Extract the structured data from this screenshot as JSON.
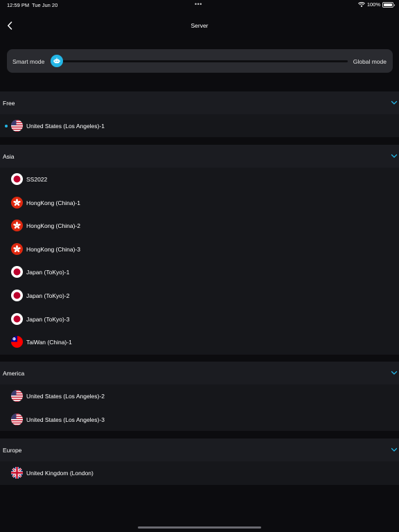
{
  "status_bar": {
    "time": "12:59 PM",
    "date": "Tue Jun 20",
    "battery": "100%"
  },
  "nav": {
    "title": "Server"
  },
  "mode": {
    "left_label": "Smart mode",
    "right_label": "Global mode",
    "selected": "Smart mode"
  },
  "groups": [
    {
      "title": "Free",
      "items": [
        {
          "label": "United States (Los Angeles)-1",
          "flag": "us",
          "selected": true
        }
      ]
    },
    {
      "title": "Asia",
      "items": [
        {
          "label": "SS2022",
          "flag": "jp"
        },
        {
          "label": "HongKong (China)-1",
          "flag": "hk"
        },
        {
          "label": "HongKong (China)-2",
          "flag": "hk"
        },
        {
          "label": "HongKong (China)-3",
          "flag": "hk"
        },
        {
          "label": "Japan (ToKyo)-1",
          "flag": "jp"
        },
        {
          "label": "Japan (ToKyo)-2",
          "flag": "jp"
        },
        {
          "label": "Japan (ToKyo)-3",
          "flag": "jp"
        },
        {
          "label": "TaiWan (China)-1",
          "flag": "tw"
        }
      ]
    },
    {
      "title": "America",
      "items": [
        {
          "label": "United States (Los Angeles)-2",
          "flag": "us"
        },
        {
          "label": "United States (Los Angeles)-3",
          "flag": "us"
        }
      ]
    },
    {
      "title": "Europe",
      "items": [
        {
          "label": "United Kingdom (London)",
          "flag": "gb"
        }
      ]
    }
  ],
  "icons": {
    "back": "chevron-left-icon",
    "expand": "chevron-down-icon",
    "mode_thumb": "robot-icon",
    "wifi": "wifi-icon",
    "battery": "battery-icon"
  },
  "colors": {
    "background": "#0c0c0f",
    "accent": "#23b6e6",
    "group_header": "#1b1c21",
    "group_body": "#16171b",
    "mode_panel": "#2a2b30"
  }
}
